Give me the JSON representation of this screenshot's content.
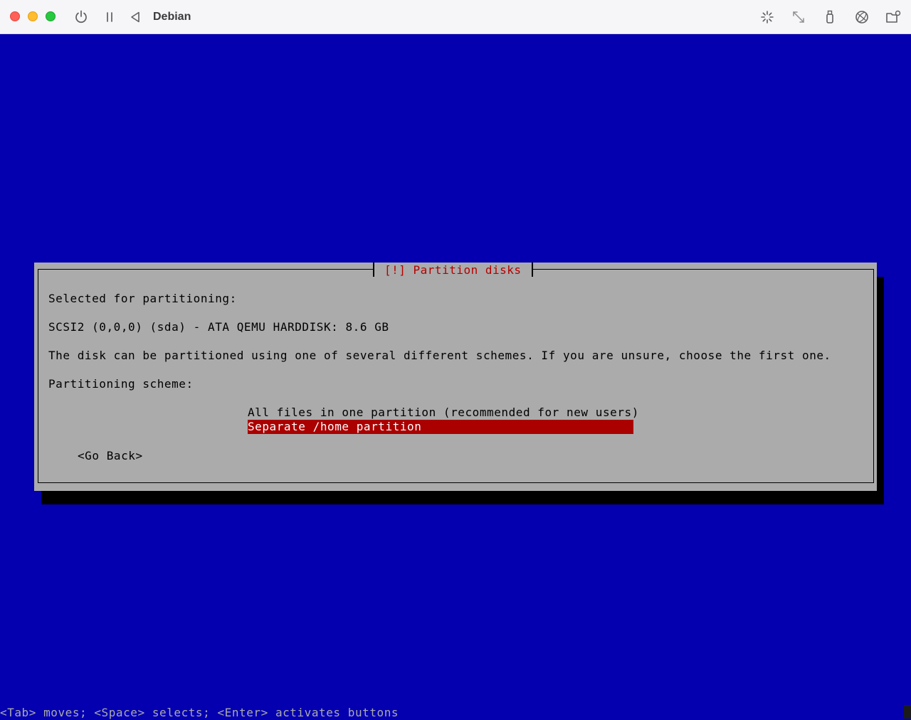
{
  "window": {
    "title": "Debian",
    "toolbar_icons": [
      "power-icon",
      "pause-icon",
      "back-icon",
      "spinner-icon",
      "resize-icon",
      "usb-icon",
      "network-icon",
      "shared-folder-icon"
    ]
  },
  "dialog": {
    "title": "[!] Partition disks",
    "line_selected_for": "Selected for partitioning:",
    "line_disk": "SCSI2 (0,0,0) (sda) - ATA QEMU HARDDISK: 8.6 GB",
    "line_description": "The disk can be partitioned using one of several different schemes. If you are unsure, choose the first one.",
    "line_scheme_label": "Partitioning scheme:",
    "options": [
      {
        "label": "All files in one partition (recommended for new users)",
        "selected": false
      },
      {
        "label": "Separate /home partition",
        "selected": true
      }
    ],
    "go_back_label": "<Go Back>"
  },
  "help_line": "<Tab> moves; <Space> selects; <Enter> activates buttons",
  "colors": {
    "background": "#0400b0",
    "dialog": "#ababab",
    "title_text": "#b30000",
    "selected_option": "#aa0000"
  }
}
